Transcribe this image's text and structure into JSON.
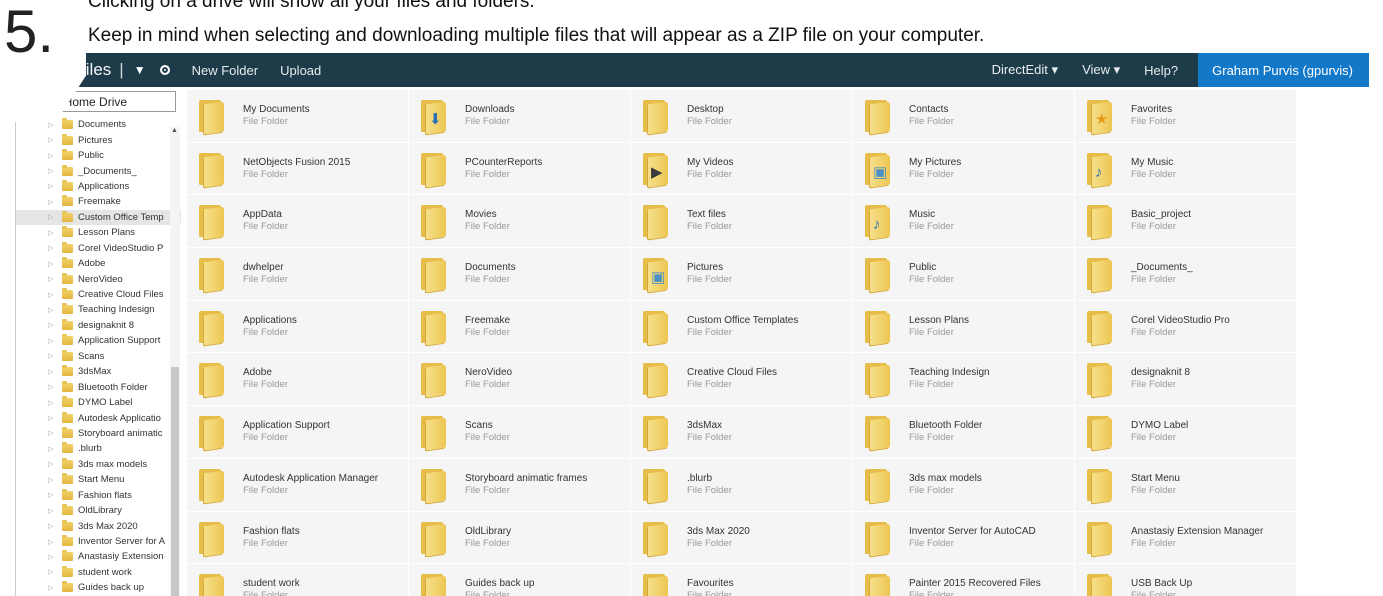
{
  "step": {
    "number": "5."
  },
  "instructions": {
    "line1": "Clicking on a drive will show all your files and folders.",
    "line2": "Keep in mind when selecting and downloading multiple files that will appear as a ZIP file on your computer."
  },
  "topbar": {
    "title": "My Files",
    "separator": "|",
    "menu_caret": "▼",
    "new_folder": "New Folder",
    "upload": "Upload",
    "directedit": "DirectEdit ▾",
    "view": "View ▾",
    "help": "Help?",
    "user": "Graham Purvis (gpurvis)"
  },
  "sidebar": {
    "search_value": "earch: Home Drive",
    "items": [
      "Documents",
      "Pictures",
      "Public",
      "_Documents_",
      "Applications",
      "Freemake",
      "Custom Office Temp",
      "Lesson Plans",
      "Corel VideoStudio P",
      "Adobe",
      "NeroVideo",
      "Creative Cloud Files",
      "Teaching Indesign",
      "designaknit 8",
      "Application Support",
      "Scans",
      "3dsMax",
      "Bluetooth Folder",
      "DYMO Label",
      "Autodesk Applicatio",
      "Storyboard animatic",
      ".blurb",
      "3ds max models",
      "Start Menu",
      "Fashion flats",
      "OldLibrary",
      "3ds Max 2020",
      "Inventor Server for A",
      "Anastasiy Extension",
      "student work",
      "Guides back up"
    ],
    "selected_index": 6
  },
  "files": {
    "type_label": "File Folder",
    "items": [
      {
        "name": "My Documents",
        "icon": "folder-icon"
      },
      {
        "name": "Downloads",
        "icon": "downloads-folder-icon"
      },
      {
        "name": "Desktop",
        "icon": "folder-icon"
      },
      {
        "name": "Contacts",
        "icon": "folder-icon"
      },
      {
        "name": "Favorites",
        "icon": "favorites-folder-icon"
      },
      {
        "name": "NetObjects Fusion 2015",
        "icon": "folder-icon"
      },
      {
        "name": "PCounterReports",
        "icon": "folder-icon"
      },
      {
        "name": "My Videos",
        "icon": "videos-folder-icon"
      },
      {
        "name": "My Pictures",
        "icon": "pictures-folder-icon"
      },
      {
        "name": "My Music",
        "icon": "music-folder-icon"
      },
      {
        "name": "AppData",
        "icon": "folder-icon"
      },
      {
        "name": "Movies",
        "icon": "folder-icon"
      },
      {
        "name": "Text files",
        "icon": "folder-icon"
      },
      {
        "name": "Music",
        "icon": "music-folder-icon"
      },
      {
        "name": "Basic_project",
        "icon": "folder-icon"
      },
      {
        "name": "dwhelper",
        "icon": "folder-icon"
      },
      {
        "name": "Documents",
        "icon": "folder-icon"
      },
      {
        "name": "Pictures",
        "icon": "pictures-folder-icon"
      },
      {
        "name": "Public",
        "icon": "folder-icon"
      },
      {
        "name": "_Documents_",
        "icon": "folder-icon"
      },
      {
        "name": "Applications",
        "icon": "folder-icon"
      },
      {
        "name": "Freemake",
        "icon": "folder-icon"
      },
      {
        "name": "Custom Office Templates",
        "icon": "folder-icon"
      },
      {
        "name": "Lesson Plans",
        "icon": "folder-icon"
      },
      {
        "name": "Corel VideoStudio Pro",
        "icon": "folder-icon"
      },
      {
        "name": "Adobe",
        "icon": "folder-icon"
      },
      {
        "name": "NeroVideo",
        "icon": "folder-icon"
      },
      {
        "name": "Creative Cloud Files",
        "icon": "folder-icon"
      },
      {
        "name": "Teaching Indesign",
        "icon": "folder-icon"
      },
      {
        "name": "designaknit 8",
        "icon": "folder-icon"
      },
      {
        "name": "Application Support",
        "icon": "folder-icon"
      },
      {
        "name": "Scans",
        "icon": "folder-icon"
      },
      {
        "name": "3dsMax",
        "icon": "folder-icon"
      },
      {
        "name": "Bluetooth Folder",
        "icon": "folder-icon"
      },
      {
        "name": "DYMO Label",
        "icon": "folder-icon"
      },
      {
        "name": "Autodesk Application Manager",
        "icon": "folder-icon"
      },
      {
        "name": "Storyboard animatic frames",
        "icon": "folder-icon"
      },
      {
        "name": ".blurb",
        "icon": "folder-icon"
      },
      {
        "name": "3ds max models",
        "icon": "folder-icon"
      },
      {
        "name": "Start Menu",
        "icon": "folder-icon"
      },
      {
        "name": "Fashion flats",
        "icon": "folder-icon"
      },
      {
        "name": "OldLibrary",
        "icon": "folder-icon"
      },
      {
        "name": "3ds Max 2020",
        "icon": "folder-icon"
      },
      {
        "name": "Inventor Server for AutoCAD",
        "icon": "folder-icon"
      },
      {
        "name": "Anastasiy Extension Manager",
        "icon": "folder-icon"
      },
      {
        "name": "student work",
        "icon": "folder-icon"
      },
      {
        "name": "Guides back up",
        "icon": "folder-icon"
      },
      {
        "name": "Favourites",
        "icon": "folder-icon"
      },
      {
        "name": "Painter 2015 Recovered Files",
        "icon": "folder-icon"
      },
      {
        "name": "USB Back Up",
        "icon": "folder-icon"
      }
    ]
  },
  "colors": {
    "topbar": "#1e3b4a",
    "user_button": "#1478c8",
    "tile": "#f5f5f5",
    "folder": "#edc653"
  }
}
